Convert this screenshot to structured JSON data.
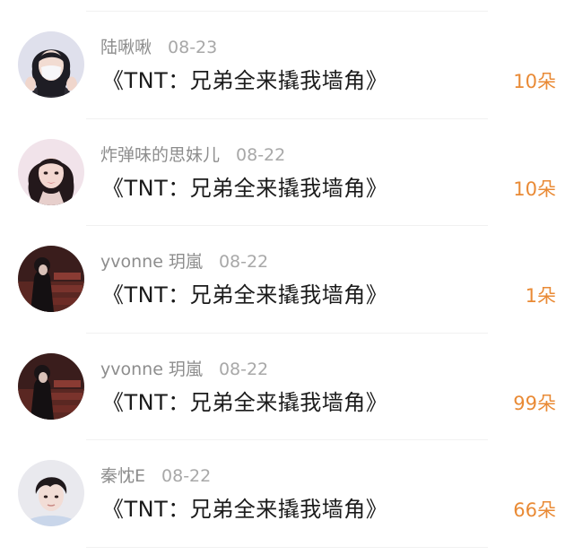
{
  "items": [
    {
      "username": "陆啾啾",
      "date": "08-23",
      "title": "《TNT：兄弟全来撬我墙角》",
      "count": "10朵",
      "avatar_icon": "girl-with-mask-avatar"
    },
    {
      "username": "炸弹味的思妹儿",
      "date": "08-22",
      "title": "《TNT：兄弟全来撬我墙角》",
      "count": "10朵",
      "avatar_icon": "woman-portrait-avatar"
    },
    {
      "username": "yvonne 玥嵐",
      "date": "08-22",
      "title": "《TNT：兄弟全来撬我墙角》",
      "count": "1朵",
      "avatar_icon": "dark-theater-avatar"
    },
    {
      "username": "yvonne 玥嵐",
      "date": "08-22",
      "title": "《TNT：兄弟全来撬我墙角》",
      "count": "99朵",
      "avatar_icon": "dark-theater-avatar"
    },
    {
      "username": "秦忱E",
      "date": "08-22",
      "title": "《TNT：兄弟全来撬我墙角》",
      "count": "66朵",
      "avatar_icon": "boy-portrait-avatar"
    }
  ],
  "colors": {
    "count_accent": "#e98a35",
    "username": "#8d8d8d",
    "date": "#a8a8a8",
    "title": "#1b1b1b",
    "divider": "#f1f1f1"
  }
}
